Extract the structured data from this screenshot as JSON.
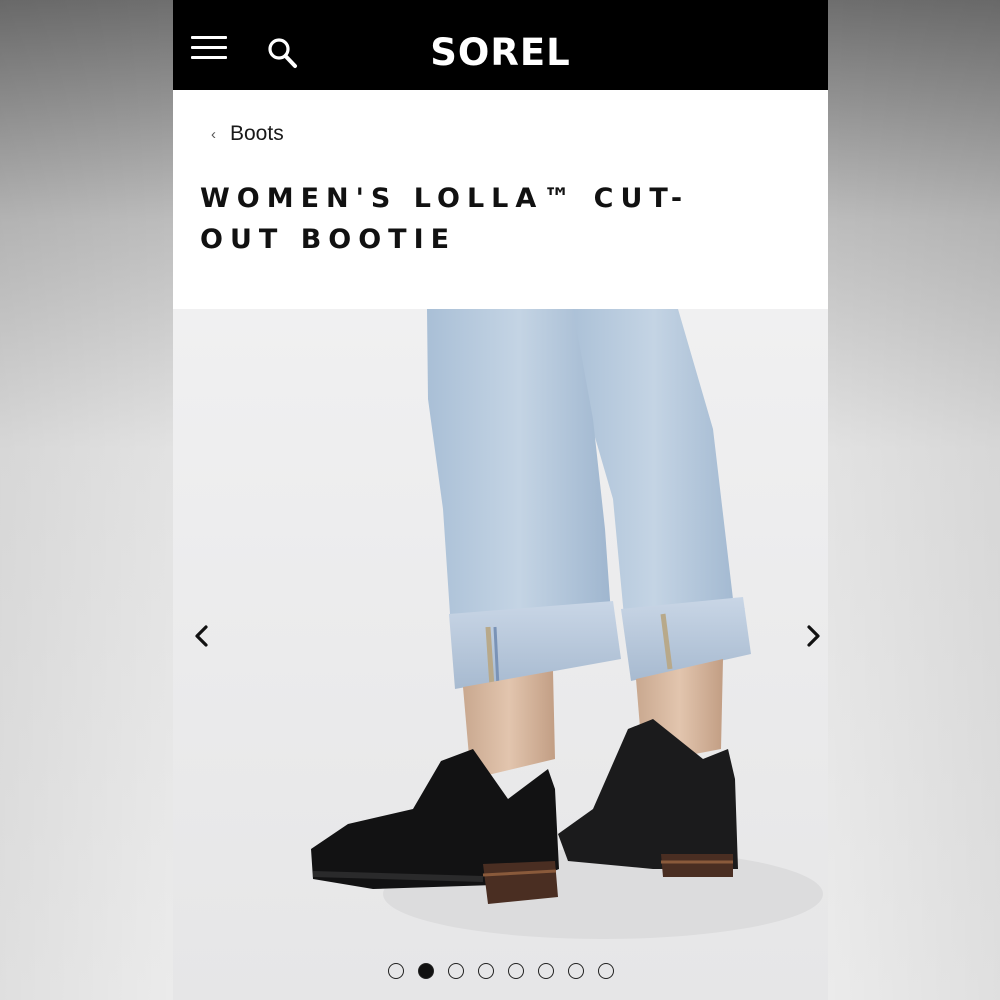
{
  "header": {
    "brand": "SOREL",
    "menu_icon": "hamburger-menu-icon",
    "search_icon": "search-icon"
  },
  "breadcrumb": {
    "label": "Boots",
    "icon": "chevron-left-icon"
  },
  "product": {
    "title": "WOMEN'S LOLLA™ CUT-OUT BOOTIE"
  },
  "carousel": {
    "image": "product-photo-jeans-black-ankle-booties",
    "slide_count": 8,
    "active_index": 1,
    "prev_icon": "chevron-left-icon",
    "next_icon": "chevron-right-icon"
  },
  "colors": {
    "header_bg": "#000000",
    "panel_bg": "#ffffff",
    "text": "#111111",
    "photo_bg": "#ececed"
  }
}
